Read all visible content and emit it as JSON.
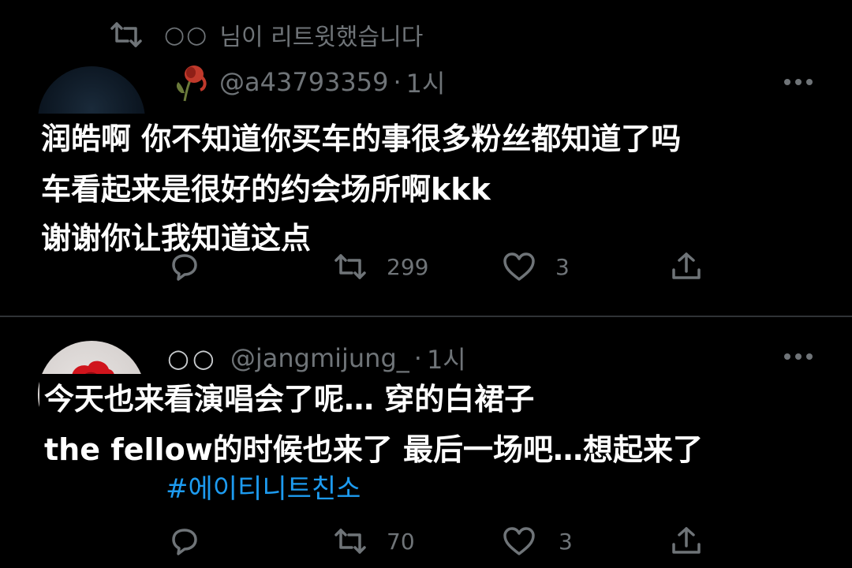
{
  "retweet_banner": {
    "retweeter": "○○",
    "text": "님이 리트윗했습니다"
  },
  "tweets": [
    {
      "handle": "@a43793359",
      "separator": "·",
      "time": "1시",
      "subtitle_lines": [
        "润皓啊  你不知道你买车的事很多粉丝都知道了吗",
        "车看起来是很好的约会场所啊kkk",
        "谢谢你让我知道这点"
      ],
      "retweets": "299",
      "likes": "3"
    },
    {
      "name": "○○",
      "handle": "@jangmijung_",
      "separator": "·",
      "time": "1시",
      "subtitle_lines": [
        "今天也来看演唱会了呢… 穿的白裙子",
        "the fellow的时候也来了  最后一场吧…想起来了"
      ],
      "hashtag": "#에이티니트친소",
      "retweets": "70",
      "likes": "3"
    }
  ],
  "colors": {
    "background": "#000000",
    "secondary_text": "#6f7478",
    "link": "#1d9bf0",
    "divider": "#2f3336"
  },
  "icons": [
    "retweet-icon",
    "rose-icon",
    "more-icon",
    "reply-icon",
    "like-icon",
    "share-icon"
  ]
}
